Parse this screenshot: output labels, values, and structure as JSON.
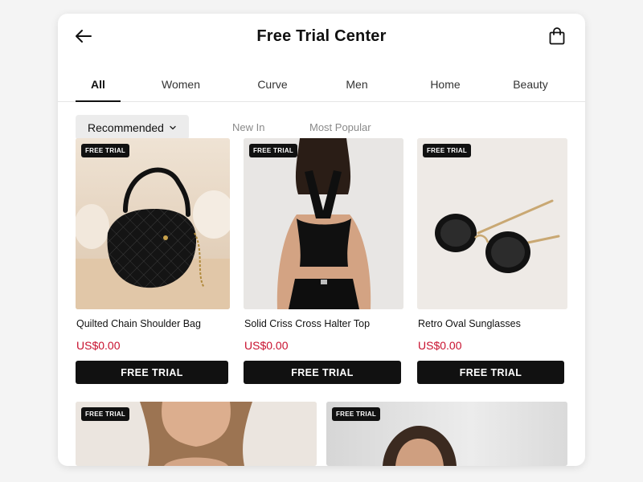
{
  "header": {
    "title": "Free Trial Center",
    "back_icon": "arrow-left-icon",
    "bag_icon": "shopping-bag-icon"
  },
  "tabs": [
    {
      "label": "All",
      "active": true
    },
    {
      "label": "Women",
      "active": false
    },
    {
      "label": "Curve",
      "active": false
    },
    {
      "label": "Men",
      "active": false
    },
    {
      "label": "Home",
      "active": false
    },
    {
      "label": "Beauty",
      "active": false
    }
  ],
  "filters": {
    "sort": {
      "selected": "Recommended",
      "icon": "chevron-down-icon"
    },
    "links": [
      "New In",
      "Most Popular"
    ]
  },
  "products": [
    {
      "badge": "FREE TRIAL",
      "name": "Quilted Chain Shoulder Bag",
      "price": "US$0.00",
      "button": "FREE TRIAL",
      "image": "quilted-black-shoulder-bag"
    },
    {
      "badge": "FREE TRIAL",
      "name": "Solid Criss Cross Halter Top",
      "price": "US$0.00",
      "button": "FREE TRIAL",
      "image": "black-halter-top-model"
    },
    {
      "badge": "FREE TRIAL",
      "name": "Retro Oval Sunglasses",
      "price": "US$0.00",
      "button": "FREE TRIAL",
      "image": "black-oval-sunglasses"
    },
    {
      "badge": "FREE TRIAL",
      "image": "woman-portrait"
    },
    {
      "badge": "FREE TRIAL",
      "image": "woman-portrait"
    }
  ],
  "colors": {
    "accent": "#111111",
    "price": "#c8102e",
    "filter_bg": "#ececec",
    "muted_text": "#8a8a8a"
  }
}
